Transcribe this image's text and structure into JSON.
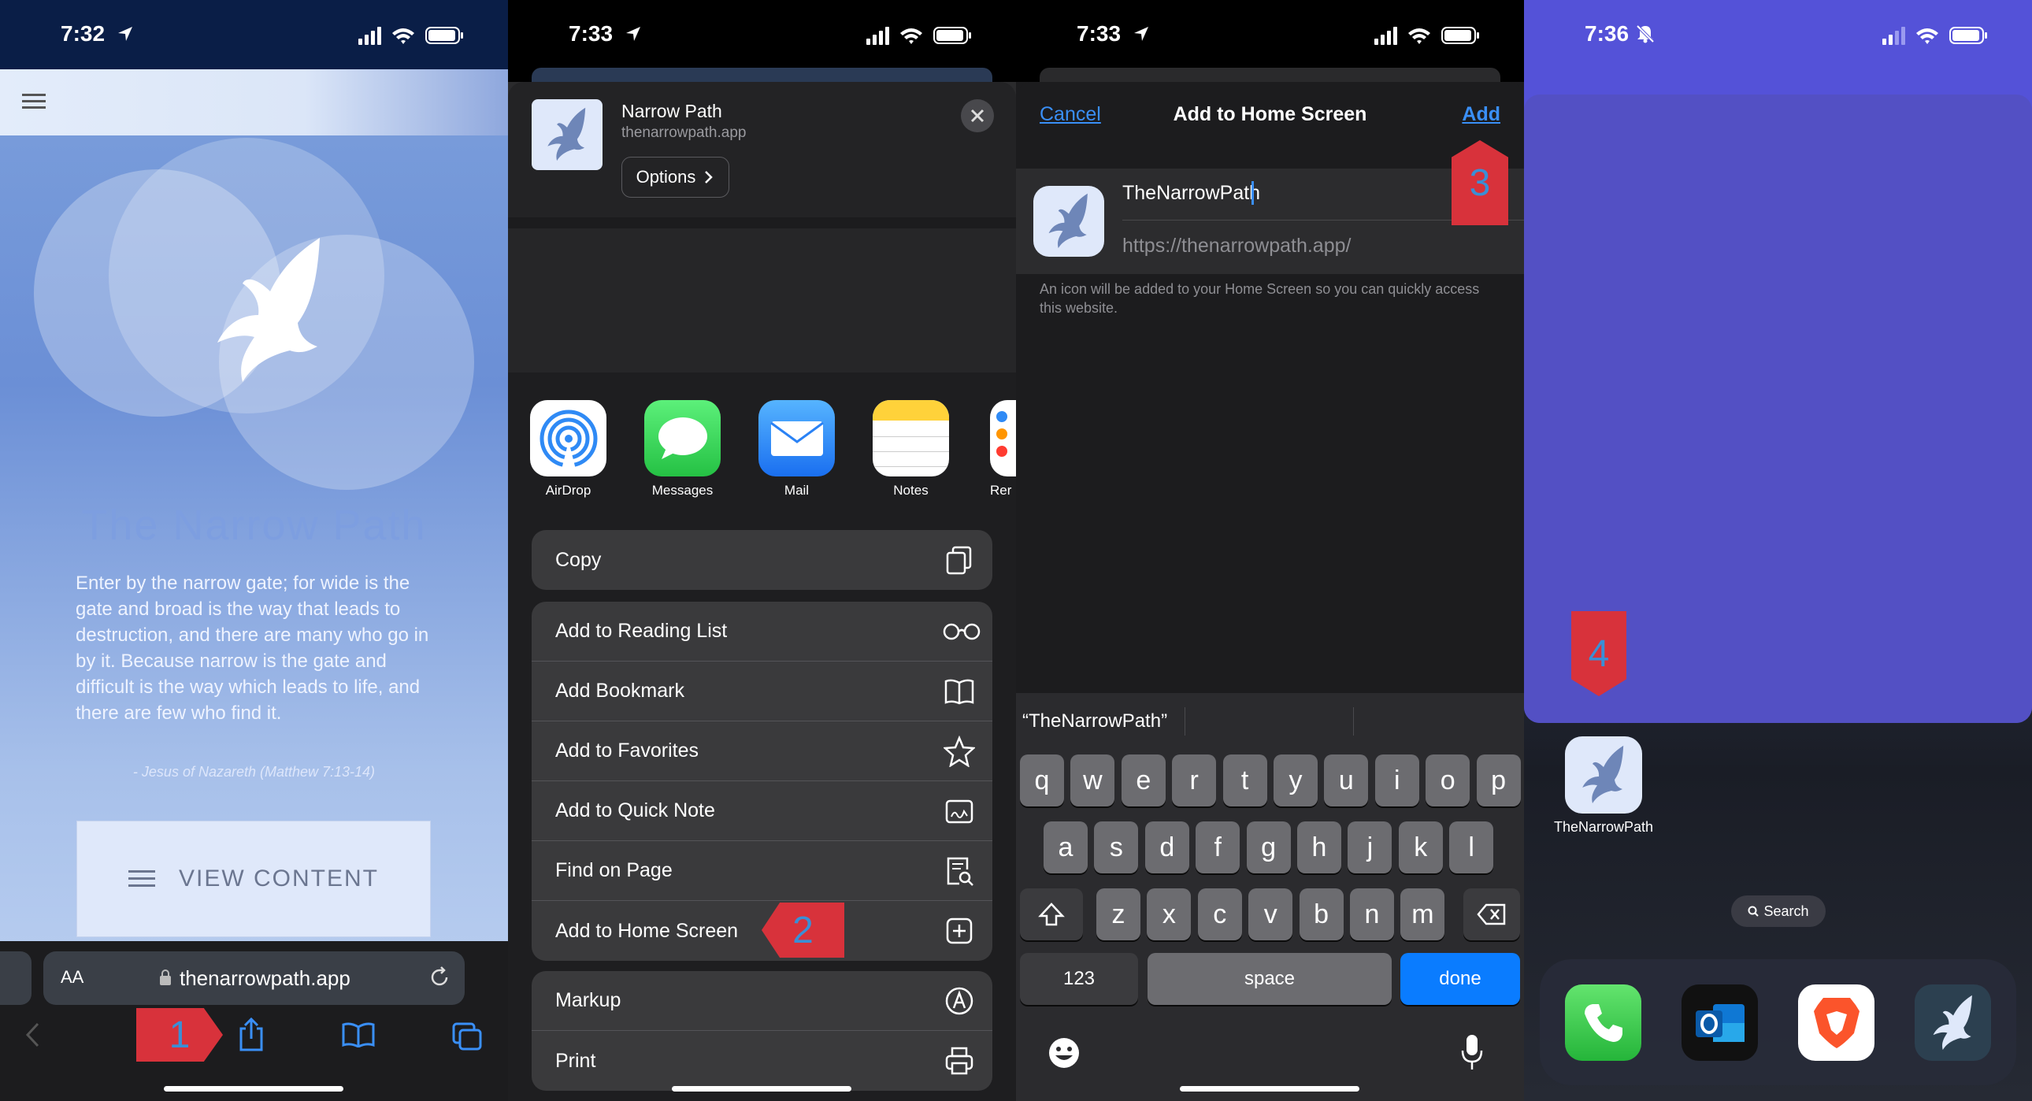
{
  "screen1": {
    "time": "7:32",
    "title": "The Narrow Path",
    "verse": "Enter by the narrow gate; for wide is the gate and broad is the way that leads to destruction, and there are many who go in by it. Because narrow is the gate and difficult is the way which leads to life, and there are few who find it.",
    "attribution": "- Jesus of Nazareth (Matthew 7:13-14)",
    "view_content": "VIEW CONTENT",
    "aa_label": "AA",
    "url": "thenarrowpath.app",
    "marker": "1",
    "colors": {
      "bg": "#6b8fd6",
      "marker": "#d8323b"
    }
  },
  "screen2": {
    "time": "7:33",
    "site_title": "Narrow Path",
    "site_domain": "thenarrowpath.app",
    "options_label": "Options",
    "apps": [
      {
        "label": "AirDrop",
        "icon": "airdrop-icon"
      },
      {
        "label": "Messages",
        "icon": "messages-icon"
      },
      {
        "label": "Mail",
        "icon": "mail-icon"
      },
      {
        "label": "Notes",
        "icon": "notes-icon"
      },
      {
        "label": "Rer",
        "icon": "reminders-icon"
      }
    ],
    "copy": "Copy",
    "group2": [
      "Add to Reading List",
      "Add Bookmark",
      "Add to Favorites",
      "Add to Quick Note",
      "Find on Page",
      "Add to Home Screen"
    ],
    "group3": [
      "Markup",
      "Print"
    ],
    "marker": "2"
  },
  "screen3": {
    "time": "7:33",
    "cancel": "Cancel",
    "title": "Add to Home Screen",
    "add": "Add",
    "name_value": "TheNarrowPath",
    "url_value": "https://thenarrowpath.app/",
    "info": "An icon will be added to your Home Screen so you can quickly access this website.",
    "suggestion": "“TheNarrowPath”",
    "rows": [
      [
        "q",
        "w",
        "e",
        "r",
        "t",
        "y",
        "u",
        "i",
        "o",
        "p"
      ],
      [
        "a",
        "s",
        "d",
        "f",
        "g",
        "h",
        "j",
        "k",
        "l"
      ],
      [
        "z",
        "x",
        "c",
        "v",
        "b",
        "n",
        "m"
      ]
    ],
    "num_key": "123",
    "space_key": "space",
    "done_key": "done",
    "marker": "3"
  },
  "screen4": {
    "time": "7:36",
    "app_label": "TheNarrowPath",
    "search_label": "Search",
    "marker": "4",
    "dock": [
      {
        "icon": "phone-icon"
      },
      {
        "icon": "outlook-icon"
      },
      {
        "icon": "brave-icon"
      },
      {
        "icon": "narrowpath-app-icon"
      }
    ]
  }
}
